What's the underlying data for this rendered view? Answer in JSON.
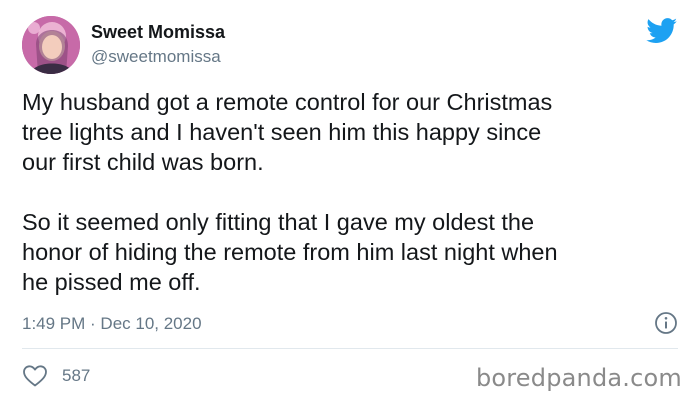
{
  "author": {
    "name": "Sweet Momissa",
    "handle": "@sweetmomissa"
  },
  "icons": {
    "avatar": "avatar",
    "brand": "twitter-bird-icon",
    "info": "info-icon",
    "like": "heart-icon"
  },
  "colors": {
    "twitter_blue": "#1da1f2",
    "secondary_text": "#657786",
    "primary_text": "#14171a"
  },
  "tweet": {
    "paragraphs": [
      "My husband got a remote control for our Christmas\ntree lights and I haven't seen him this happy since\nour first child was born.",
      "So it seemed only fitting that I gave my oldest the\nhonor of hiding the remote from him last night when\nhe pissed me off."
    ],
    "timestamp": "1:49 PM · Dec 10, 2020",
    "like_count": "587"
  },
  "watermark": "boredpanda.com"
}
